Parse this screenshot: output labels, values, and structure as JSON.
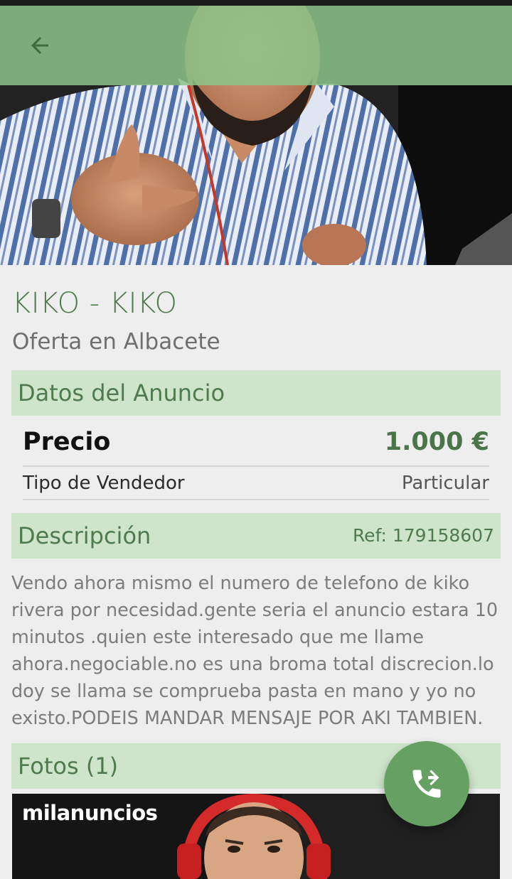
{
  "header": {
    "back_icon": "arrow-left-icon",
    "toolbar_color": "#8cc488"
  },
  "listing": {
    "title": "KIKO - KIKO",
    "subtitle": "Oferta en Albacete"
  },
  "details": {
    "section_title": "Datos del Anuncio",
    "price_label": "Precio",
    "price_value": "1.000 €",
    "seller_type_label": "Tipo de Vendedor",
    "seller_type_value": "Particular"
  },
  "description": {
    "section_title": "Descripción",
    "ref": "Ref: 179158607",
    "text": "Vendo ahora mismo el numero de telefono de kiko rivera por necesidad.gente seria el anuncio estara 10 minutos .quien este interesado que me llame ahora.negociable.no es una broma total discrecion.lo doy se llama se comprueba pasta en mano y yo no existo.PODEIS MANDAR MENSAJE POR AKI TAMBIEN."
  },
  "photos": {
    "section_title": "Fotos (1)",
    "logo_part1": "mil",
    "logo_part2": "anuncios"
  },
  "fab": {
    "icon": "phone-forward-icon",
    "color": "#66a063"
  },
  "colors": {
    "accent_green": "#4f7a4d",
    "section_bg": "#cfe5cb",
    "page_bg": "#eeeeee"
  }
}
